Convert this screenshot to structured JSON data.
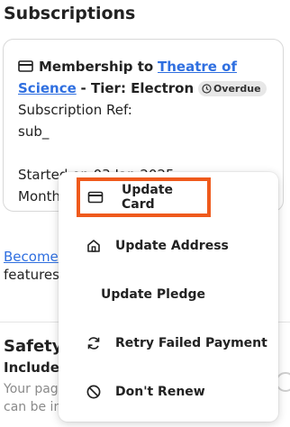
{
  "page": {
    "title": "Subscriptions"
  },
  "subscription": {
    "membership_prefix": "Membership to",
    "organization": "Theatre of Science",
    "tier_text": "- Tier: Electron",
    "status_badge": "Overdue",
    "ref_label": "Subscription Ref:",
    "ref_value": "sub_",
    "started_text": "Started on 03 Jan 2025",
    "monthly_text": "Month"
  },
  "below_card": {
    "link_text": "Become",
    "line2": "features,"
  },
  "safety": {
    "heading": "Safety",
    "include_label": "Include",
    "desc_line1": "Your page",
    "desc_line2": "can be in"
  },
  "menu": {
    "items": [
      {
        "label": "Update Card",
        "icon": "credit-card-icon"
      },
      {
        "label": "Update Address",
        "icon": "home-icon"
      },
      {
        "label": "Update Pledge",
        "icon": ""
      },
      {
        "label": "Retry Failed Payment",
        "icon": "refresh-icon"
      },
      {
        "label": "Don't Renew",
        "icon": "cancel-icon"
      }
    ]
  },
  "colors": {
    "link": "#2f6fe0",
    "highlight": "#ef5a1c",
    "badge_bg": "#e7e7e7",
    "more_button_bg": "#e3dede"
  }
}
